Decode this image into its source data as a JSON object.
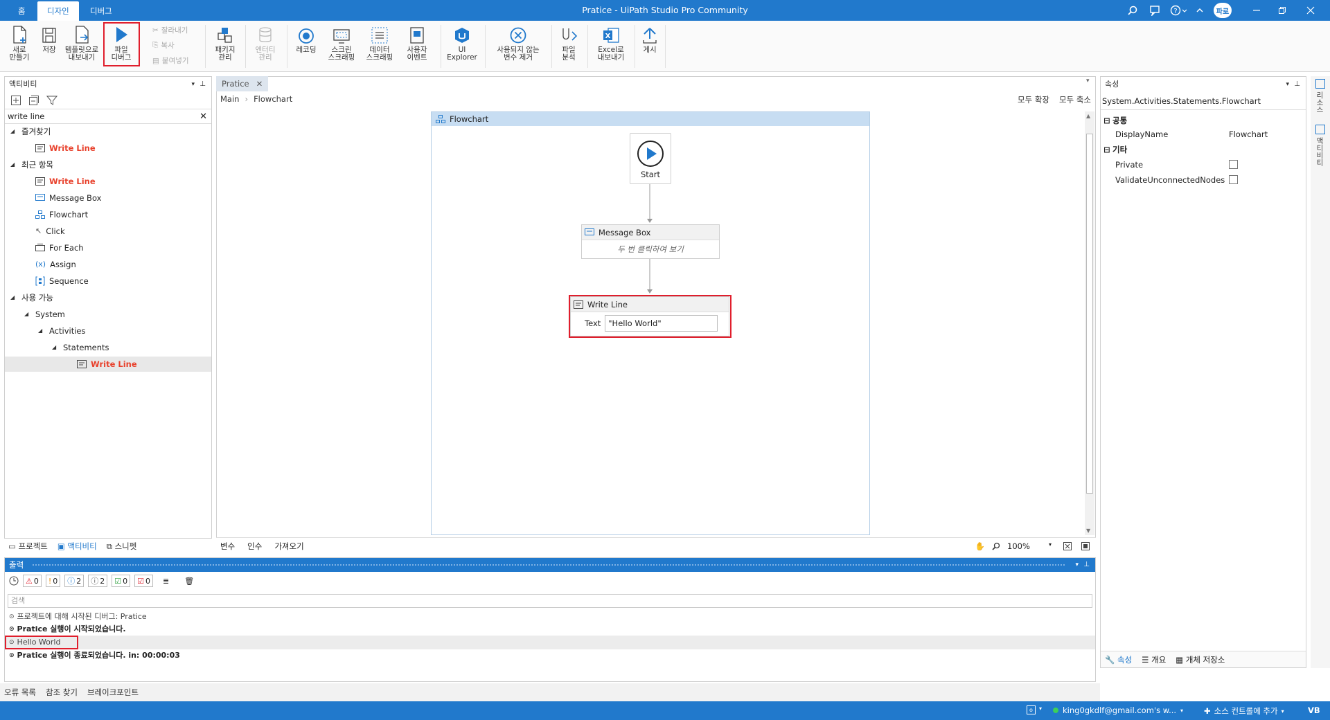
{
  "titlebar": {
    "title": "Pratice - UiPath Studio Pro Community",
    "home_tab": "홈",
    "tabs": [
      "디자인",
      "디버그"
    ],
    "user_initials": "파로"
  },
  "ribbon": {
    "new": "새로\n만들기",
    "save": "저장",
    "export_template": "템플릿으로\n내보내기",
    "debug_file": "파일\n디버그",
    "cut": "잘라내기",
    "copy": "복사",
    "paste": "붙여넣기",
    "manage_packages": "패키지\n관리",
    "manage_entities": "엔터티\n관리",
    "recording": "레코딩",
    "screen_scraping": "스크린\n스크래핑",
    "data_scraping": "데이터\n스크래핑",
    "user_events": "사용자\n이벤트",
    "ui_explorer": "UI\nExplorer",
    "remove_unused": "사용되지 않는\n변수 제거",
    "analyze_file": "파일\n분석",
    "export_excel": "Excel로\n내보내기",
    "publish": "게시"
  },
  "activities": {
    "title": "액티비티",
    "search_value": "write line",
    "groups": {
      "favorites": "즐겨찾기",
      "recent": "최근 항목",
      "available": "사용 가능"
    },
    "favorites_items": [
      "Write Line"
    ],
    "recent_items": [
      "Write Line",
      "Message Box",
      "Flowchart",
      "Click",
      "For Each",
      "Assign",
      "Sequence"
    ],
    "available_tree": [
      "System",
      "Activities",
      "Statements",
      "Write Line"
    ]
  },
  "left_tabs": [
    "프로젝트",
    "액티비티",
    "스니펫"
  ],
  "designer": {
    "doc_tab": "Pratice",
    "breadcrumb": [
      "Main",
      "Flowchart"
    ],
    "expand_all": "모두 확장",
    "collapse_all": "모두 축소",
    "flowchart_title": "Flowchart",
    "start_label": "Start",
    "message_box": {
      "title": "Message Box",
      "hint": "두 번 클릭하여 보기"
    },
    "write_line": {
      "title": "Write Line",
      "text_label": "Text",
      "text_value": "\"Hello World\""
    },
    "bottom_tabs": [
      "변수",
      "인수",
      "가져오기"
    ],
    "zoom": "100%"
  },
  "properties": {
    "title": "속성",
    "type_name": "System.Activities.Statements.Flowchart",
    "category_common": "공통",
    "category_misc": "기타",
    "display_name_label": "DisplayName",
    "display_name_value": "Flowchart",
    "private_label": "Private",
    "validate_label": "ValidateUnconnectedNodes",
    "bottom_tabs": [
      "속성",
      "개요",
      "개체 저장소"
    ]
  },
  "right_strip": [
    "리소스",
    "액티비티"
  ],
  "output": {
    "title": "출력",
    "filters": [
      "0",
      "0",
      "2",
      "2",
      "0",
      "0"
    ],
    "search_placeholder": "검색",
    "lines": [
      "프로젝트에 대해 시작된 디버그: Pratice",
      "Pratice 실행이 시작되었습니다.",
      "Hello World",
      "Pratice 실행이 종료되었습니다. in: 00:00:03"
    ]
  },
  "bottom_tabs": [
    "오류 목록",
    "참조 찾기",
    "브레이크포인트"
  ],
  "statusbar": {
    "account": "king0gkdlf@gmail.com's w...",
    "source_control": "소스 컨트롤에 추가",
    "language": "VB"
  },
  "colors": {
    "accent": "#2179cc",
    "highlight": "#e01e2c",
    "activity_red": "#e8412c"
  }
}
